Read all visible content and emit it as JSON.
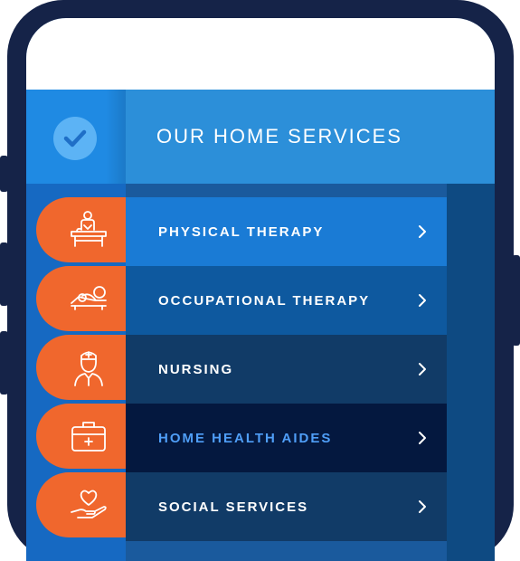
{
  "header": {
    "title": "OUR HOME SERVICES",
    "icon": "check-circle-icon"
  },
  "services": [
    {
      "label": "PHYSICAL THERAPY",
      "icon": "massage-table-icon",
      "color": "#1a7bd5",
      "highlighted": false
    },
    {
      "label": "OCCUPATIONAL THERAPY",
      "icon": "reclining-patient-icon",
      "color": "#0e599f",
      "highlighted": false
    },
    {
      "label": "NURSING",
      "icon": "nurse-icon",
      "color": "#113b67",
      "highlighted": false
    },
    {
      "label": "HOME HEALTH AIDES",
      "icon": "medical-kit-icon",
      "color": "#04183f",
      "highlighted": true
    },
    {
      "label": "SOCIAL SERVICES",
      "icon": "heart-hand-icon",
      "color": "#113b67",
      "highlighted": false
    }
  ],
  "colors": {
    "accent_orange": "#f0672d",
    "frame_navy": "#152348",
    "highlight_text": "#4f9ef7"
  }
}
